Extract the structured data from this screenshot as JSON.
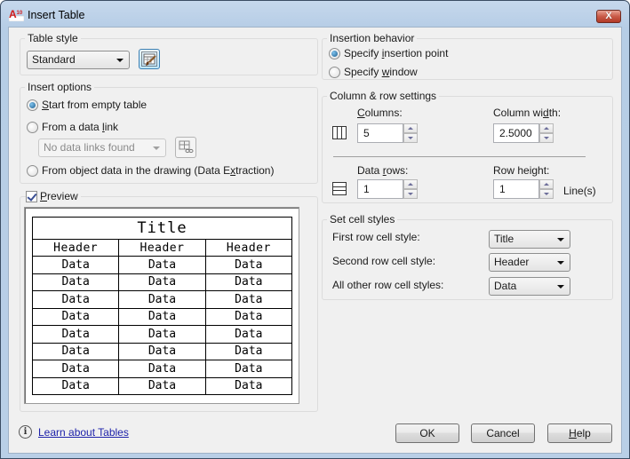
{
  "window": {
    "title": "Insert Table",
    "app_icon": "autocad-icon",
    "close_label": "X"
  },
  "table_style": {
    "label": "Table style",
    "selected": "Standard",
    "launch_button_icon": "table-style-brush-icon"
  },
  "insert_options": {
    "label": "Insert options",
    "options": [
      {
        "label_pre": "",
        "mnemonic": "S",
        "label_post": "tart from empty table",
        "checked": true
      },
      {
        "label_pre": "From a data ",
        "mnemonic": "l",
        "label_post": "ink",
        "checked": false
      },
      {
        "label_pre": "From object data in the drawing (Data E",
        "mnemonic": "x",
        "label_post": "traction)",
        "checked": false
      }
    ],
    "data_link_select": "No data links found",
    "data_link_button_icon": "data-link-manager-icon"
  },
  "preview": {
    "label_mnemonic": "P",
    "label_rest": "review",
    "checked": true,
    "table": {
      "title": "Title",
      "headers": [
        "Header",
        "Header",
        "Header"
      ],
      "rows": [
        [
          "Data",
          "Data",
          "Data"
        ],
        [
          "Data",
          "Data",
          "Data"
        ],
        [
          "Data",
          "Data",
          "Data"
        ],
        [
          "Data",
          "Data",
          "Data"
        ],
        [
          "Data",
          "Data",
          "Data"
        ],
        [
          "Data",
          "Data",
          "Data"
        ],
        [
          "Data",
          "Data",
          "Data"
        ],
        [
          "Data",
          "Data",
          "Data"
        ]
      ]
    }
  },
  "insertion_behavior": {
    "label": "Insertion behavior",
    "options": [
      {
        "label_pre": "Specify ",
        "mnemonic": "i",
        "label_post": "nsertion point",
        "checked": true
      },
      {
        "label_pre": "Specify ",
        "mnemonic": "w",
        "label_post": "indow",
        "checked": false
      }
    ]
  },
  "column_row_settings": {
    "label": "Column & row settings",
    "columns": {
      "label_pre": "",
      "mnemonic": "C",
      "label_post": "olumns:",
      "value": "5"
    },
    "column_width": {
      "label_pre": "Column wi",
      "mnemonic": "d",
      "label_post": "th:",
      "value": "2.5000"
    },
    "data_rows": {
      "label_pre": "Data ",
      "mnemonic": "r",
      "label_post": "ows:",
      "value": "1"
    },
    "row_height": {
      "label_pre": "Row hei",
      "mnemonic": "g",
      "label_post": "ht:",
      "value": "1",
      "unit": "Line(s)"
    }
  },
  "cell_styles": {
    "label": "Set cell styles",
    "first_row": {
      "label": "First row cell style:",
      "value": "Title"
    },
    "second_row": {
      "label": "Second row cell style:",
      "value": "Header"
    },
    "other_rows": {
      "label": "All other row cell styles:",
      "value": "Data"
    }
  },
  "footer": {
    "learn_link": "Learn about Tables",
    "ok": "OK",
    "cancel": "Cancel",
    "help_mnemonic": "H",
    "help_rest": "elp"
  }
}
